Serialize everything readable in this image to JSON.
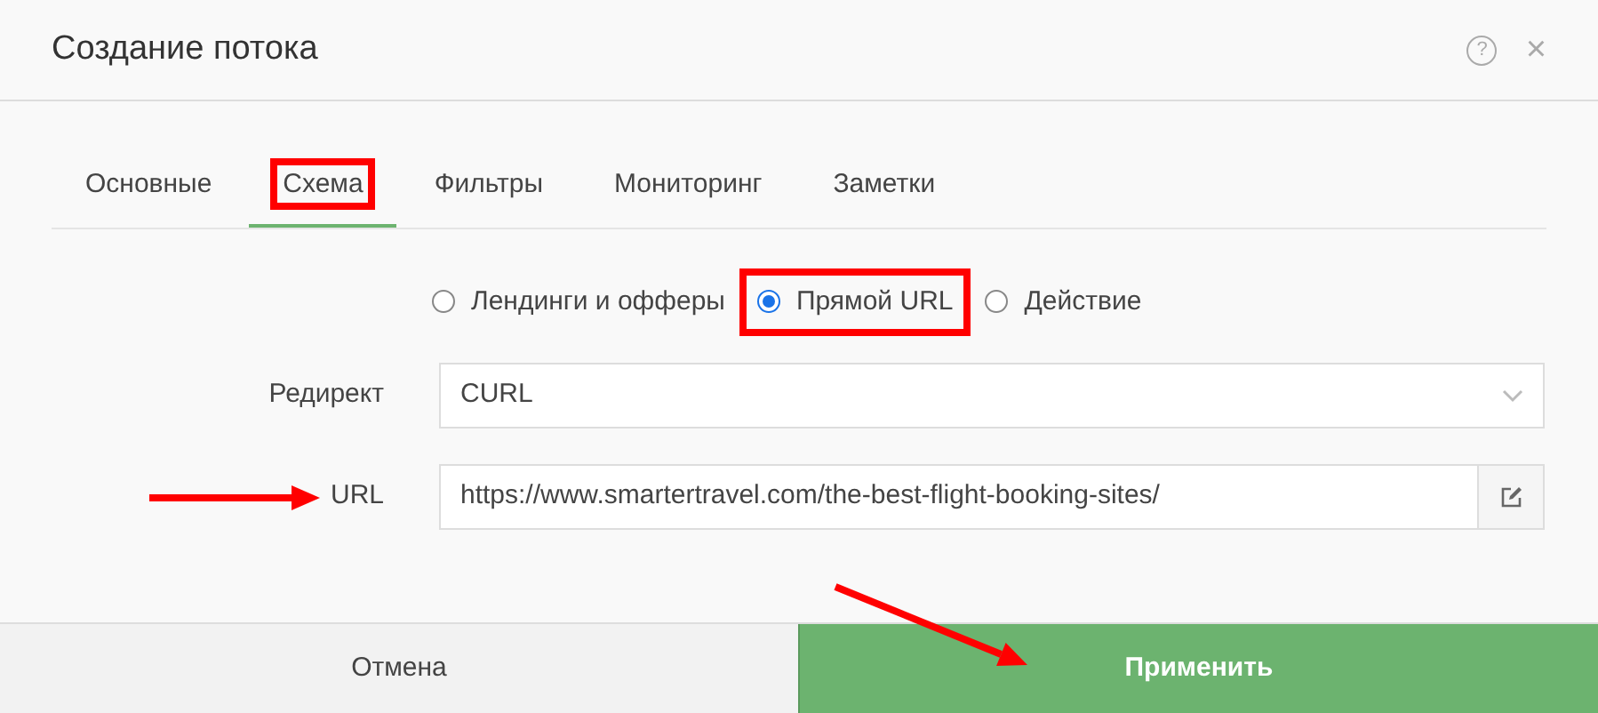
{
  "window": {
    "title": "Создание потока",
    "help": "?",
    "close": "×"
  },
  "tabs": [
    {
      "label": "Основные",
      "selected": false,
      "highlighted": false
    },
    {
      "label": "Схема",
      "selected": true,
      "highlighted": true
    },
    {
      "label": "Фильтры",
      "selected": false,
      "highlighted": false
    },
    {
      "label": "Мониторинг",
      "selected": false,
      "highlighted": false
    },
    {
      "label": "Заметки",
      "selected": false,
      "highlighted": false
    }
  ],
  "scheme_options": [
    {
      "label": "Лендинги и офферы",
      "selected": false,
      "highlighted": false
    },
    {
      "label": "Прямой URL",
      "selected": true,
      "highlighted": true
    },
    {
      "label": "Действие",
      "selected": false,
      "highlighted": false
    }
  ],
  "redirect": {
    "label": "Редирект",
    "value": "CURL"
  },
  "url": {
    "label": "URL",
    "value": "https://www.smartertravel.com/the-best-flight-booking-sites/",
    "arrow": true
  },
  "buttons": [
    {
      "label": "Отмена",
      "kind": "cancel",
      "arrow": false
    },
    {
      "label": "Применить",
      "kind": "apply",
      "arrow": true
    }
  ]
}
